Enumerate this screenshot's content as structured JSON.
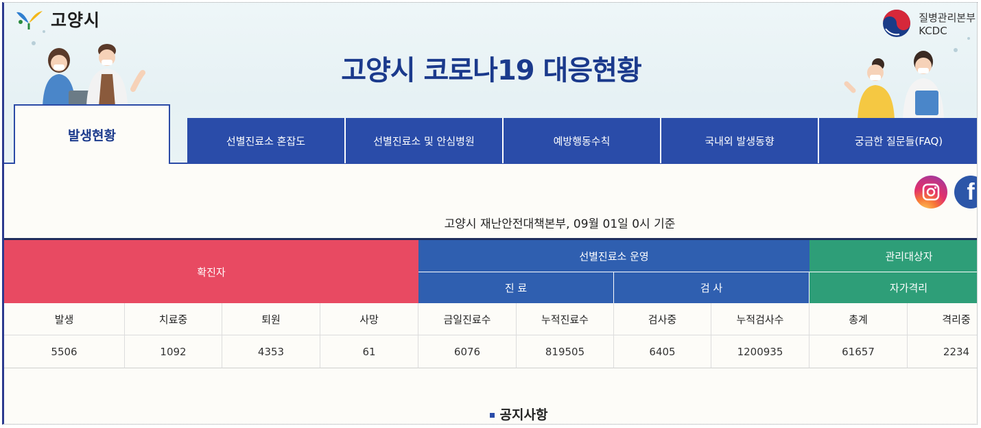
{
  "header": {
    "city_name": "고양시",
    "agency_line1": "질병관리본부",
    "agency_line2": "KCDC",
    "title": "고양시 코로나19 대응현황"
  },
  "tabs": [
    {
      "label": "발생현황",
      "active": true
    },
    {
      "label": "선별진료소 혼잡도"
    },
    {
      "label": "선별진료소 및 안심병원"
    },
    {
      "label": "예방행동수칙"
    },
    {
      "label": "국내외 발생동향"
    },
    {
      "label": "궁금한 질문들(FAQ)"
    }
  ],
  "social": {
    "instagram": "instagram-icon",
    "facebook_glyph": "f"
  },
  "basis_text": "고양시 재난안전대책본부, 09월 01일 0시 기준",
  "table": {
    "group_confirmed": "확진자",
    "group_clinic": "선별진료소 운영",
    "sub_treatment": "진 료",
    "sub_test": "검 사",
    "group_mgmt": "관리대상자",
    "sub_selfiso": "자가격리",
    "columns": [
      "발생",
      "치료중",
      "퇴원",
      "사망",
      "금일진료수",
      "누적진료수",
      "검사중",
      "누적검사수",
      "총계",
      "격리중"
    ],
    "values": [
      "5506",
      "1092",
      "4353",
      "61",
      "6076",
      "819505",
      "6405",
      "1200935",
      "61657",
      "2234"
    ]
  },
  "notice_title": "공지사항",
  "colors": {
    "primary": "#2a4ca9",
    "title": "#1b3a8c",
    "confirmed": "#e84a62",
    "clinic": "#2f5fb0",
    "mgmt": "#2e9e78"
  }
}
